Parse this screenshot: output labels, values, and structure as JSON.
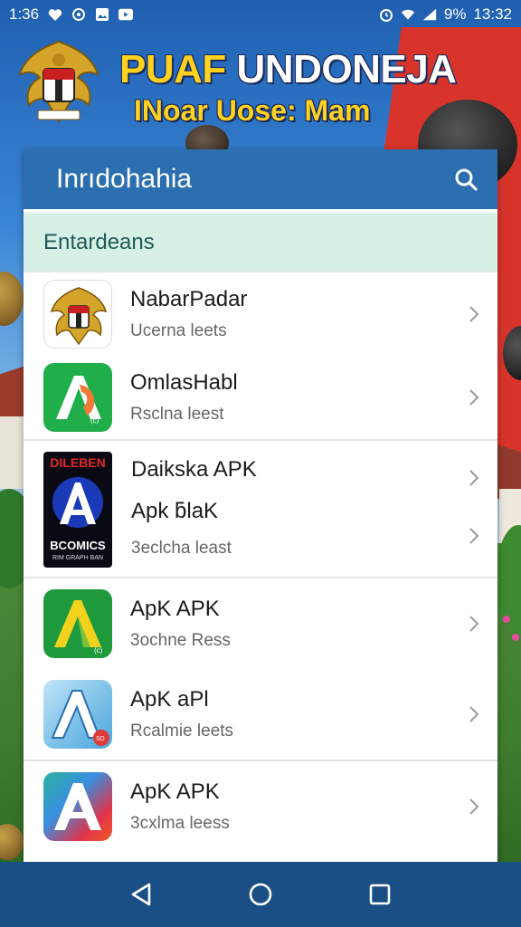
{
  "status_bar": {
    "time_left": "1:36",
    "battery": "9%",
    "time_right": "13:32",
    "icons_left": [
      "heart-icon",
      "refresh-icon",
      "image-icon",
      "youtube-icon"
    ],
    "icons_right": [
      "alarm-icon",
      "wifi-icon",
      "signal-icon"
    ]
  },
  "banner": {
    "title_part1": "PUAF",
    "title_part2": "UNDONEJA",
    "subtitle": "INoar Uose: Mam"
  },
  "search": {
    "title": "Inrıdohahia",
    "icon": "search-icon"
  },
  "section": {
    "title": "Entardeans"
  },
  "apps": [
    {
      "name": "NabarPadar",
      "sub": "Ucerna leets",
      "icon": "emblem-icon"
    },
    {
      "name": "OmlasHabl",
      "sub": "Rsclna leest",
      "icon": "green-a-icon"
    },
    {
      "name": "Daikska APK",
      "sub": "",
      "icon": "dark-a-icon",
      "badge_top": "DILEBEN",
      "badge_bottom": "BCOMICS",
      "badge_small": "RIM GRAPH BAN"
    },
    {
      "name": "Apk ƃlaK",
      "sub": "3eclcha least",
      "icon": "none"
    },
    {
      "name": "ApK APK",
      "sub": "3ochne Ress",
      "icon": "green-yellow-a-icon"
    },
    {
      "name": "ApK aPl",
      "sub": "Rcalmie leets",
      "icon": "blue-a-icon"
    },
    {
      "name": "ApK APK",
      "sub": "3cxlma leess",
      "icon": "multicolor-a-icon"
    }
  ],
  "nav": [
    "back-icon",
    "home-icon",
    "recents-icon"
  ],
  "colors": {
    "header_blue": "#2c6fb0",
    "section_mint": "#d7f0e6",
    "nav_blue": "#1a4f86",
    "banner_yellow": "#ffd21f"
  }
}
